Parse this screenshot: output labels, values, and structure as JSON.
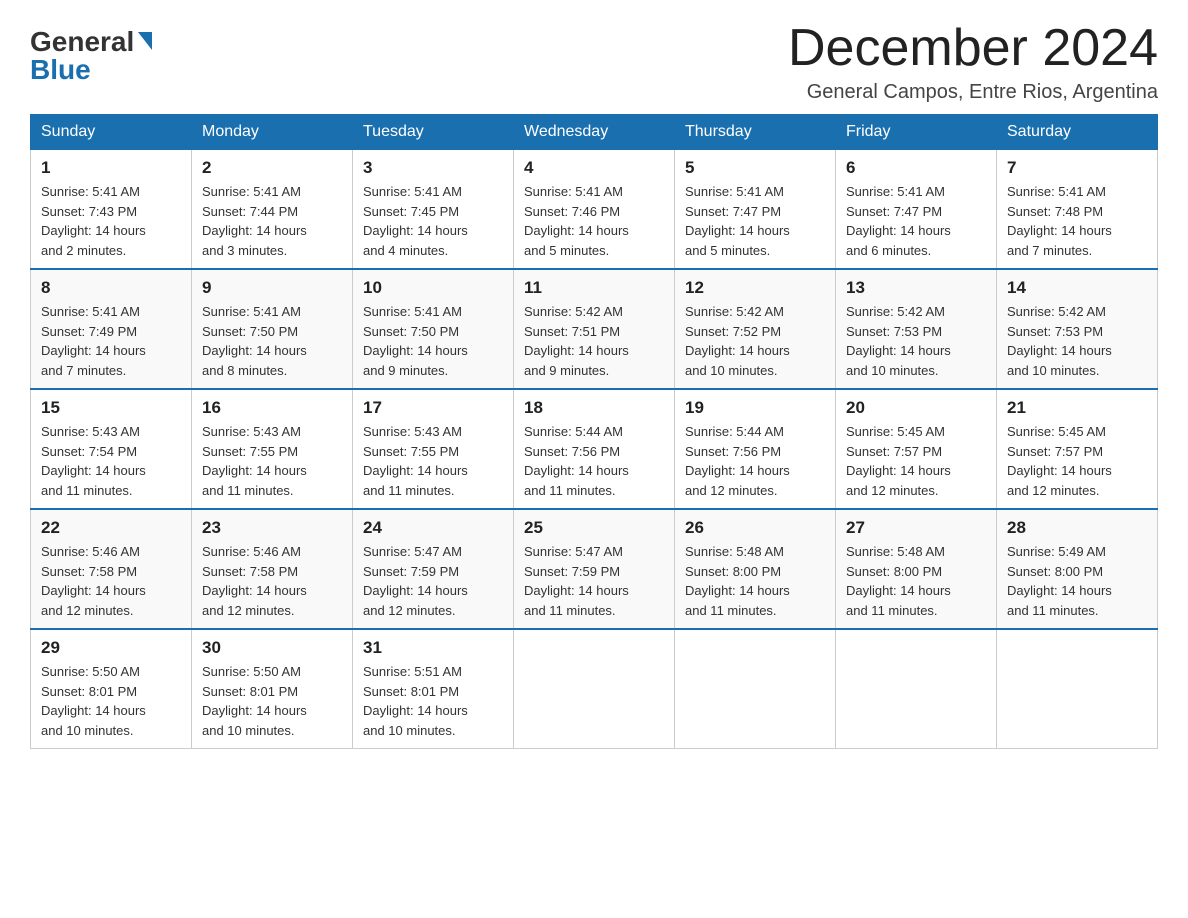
{
  "header": {
    "logo": {
      "general": "General",
      "blue": "Blue"
    },
    "month_title": "December 2024",
    "location": "General Campos, Entre Rios, Argentina"
  },
  "days_of_week": [
    "Sunday",
    "Monday",
    "Tuesday",
    "Wednesday",
    "Thursday",
    "Friday",
    "Saturday"
  ],
  "weeks": [
    [
      {
        "day": 1,
        "sunrise": "5:41 AM",
        "sunset": "7:43 PM",
        "daylight": "14 hours and 2 minutes."
      },
      {
        "day": 2,
        "sunrise": "5:41 AM",
        "sunset": "7:44 PM",
        "daylight": "14 hours and 3 minutes."
      },
      {
        "day": 3,
        "sunrise": "5:41 AM",
        "sunset": "7:45 PM",
        "daylight": "14 hours and 4 minutes."
      },
      {
        "day": 4,
        "sunrise": "5:41 AM",
        "sunset": "7:46 PM",
        "daylight": "14 hours and 5 minutes."
      },
      {
        "day": 5,
        "sunrise": "5:41 AM",
        "sunset": "7:47 PM",
        "daylight": "14 hours and 5 minutes."
      },
      {
        "day": 6,
        "sunrise": "5:41 AM",
        "sunset": "7:47 PM",
        "daylight": "14 hours and 6 minutes."
      },
      {
        "day": 7,
        "sunrise": "5:41 AM",
        "sunset": "7:48 PM",
        "daylight": "14 hours and 7 minutes."
      }
    ],
    [
      {
        "day": 8,
        "sunrise": "5:41 AM",
        "sunset": "7:49 PM",
        "daylight": "14 hours and 7 minutes."
      },
      {
        "day": 9,
        "sunrise": "5:41 AM",
        "sunset": "7:50 PM",
        "daylight": "14 hours and 8 minutes."
      },
      {
        "day": 10,
        "sunrise": "5:41 AM",
        "sunset": "7:50 PM",
        "daylight": "14 hours and 9 minutes."
      },
      {
        "day": 11,
        "sunrise": "5:42 AM",
        "sunset": "7:51 PM",
        "daylight": "14 hours and 9 minutes."
      },
      {
        "day": 12,
        "sunrise": "5:42 AM",
        "sunset": "7:52 PM",
        "daylight": "14 hours and 10 minutes."
      },
      {
        "day": 13,
        "sunrise": "5:42 AM",
        "sunset": "7:53 PM",
        "daylight": "14 hours and 10 minutes."
      },
      {
        "day": 14,
        "sunrise": "5:42 AM",
        "sunset": "7:53 PM",
        "daylight": "14 hours and 10 minutes."
      }
    ],
    [
      {
        "day": 15,
        "sunrise": "5:43 AM",
        "sunset": "7:54 PM",
        "daylight": "14 hours and 11 minutes."
      },
      {
        "day": 16,
        "sunrise": "5:43 AM",
        "sunset": "7:55 PM",
        "daylight": "14 hours and 11 minutes."
      },
      {
        "day": 17,
        "sunrise": "5:43 AM",
        "sunset": "7:55 PM",
        "daylight": "14 hours and 11 minutes."
      },
      {
        "day": 18,
        "sunrise": "5:44 AM",
        "sunset": "7:56 PM",
        "daylight": "14 hours and 11 minutes."
      },
      {
        "day": 19,
        "sunrise": "5:44 AM",
        "sunset": "7:56 PM",
        "daylight": "14 hours and 12 minutes."
      },
      {
        "day": 20,
        "sunrise": "5:45 AM",
        "sunset": "7:57 PM",
        "daylight": "14 hours and 12 minutes."
      },
      {
        "day": 21,
        "sunrise": "5:45 AM",
        "sunset": "7:57 PM",
        "daylight": "14 hours and 12 minutes."
      }
    ],
    [
      {
        "day": 22,
        "sunrise": "5:46 AM",
        "sunset": "7:58 PM",
        "daylight": "14 hours and 12 minutes."
      },
      {
        "day": 23,
        "sunrise": "5:46 AM",
        "sunset": "7:58 PM",
        "daylight": "14 hours and 12 minutes."
      },
      {
        "day": 24,
        "sunrise": "5:47 AM",
        "sunset": "7:59 PM",
        "daylight": "14 hours and 12 minutes."
      },
      {
        "day": 25,
        "sunrise": "5:47 AM",
        "sunset": "7:59 PM",
        "daylight": "14 hours and 11 minutes."
      },
      {
        "day": 26,
        "sunrise": "5:48 AM",
        "sunset": "8:00 PM",
        "daylight": "14 hours and 11 minutes."
      },
      {
        "day": 27,
        "sunrise": "5:48 AM",
        "sunset": "8:00 PM",
        "daylight": "14 hours and 11 minutes."
      },
      {
        "day": 28,
        "sunrise": "5:49 AM",
        "sunset": "8:00 PM",
        "daylight": "14 hours and 11 minutes."
      }
    ],
    [
      {
        "day": 29,
        "sunrise": "5:50 AM",
        "sunset": "8:01 PM",
        "daylight": "14 hours and 10 minutes."
      },
      {
        "day": 30,
        "sunrise": "5:50 AM",
        "sunset": "8:01 PM",
        "daylight": "14 hours and 10 minutes."
      },
      {
        "day": 31,
        "sunrise": "5:51 AM",
        "sunset": "8:01 PM",
        "daylight": "14 hours and 10 minutes."
      },
      null,
      null,
      null,
      null
    ]
  ],
  "labels": {
    "sunrise": "Sunrise:",
    "sunset": "Sunset:",
    "daylight": "Daylight:"
  }
}
